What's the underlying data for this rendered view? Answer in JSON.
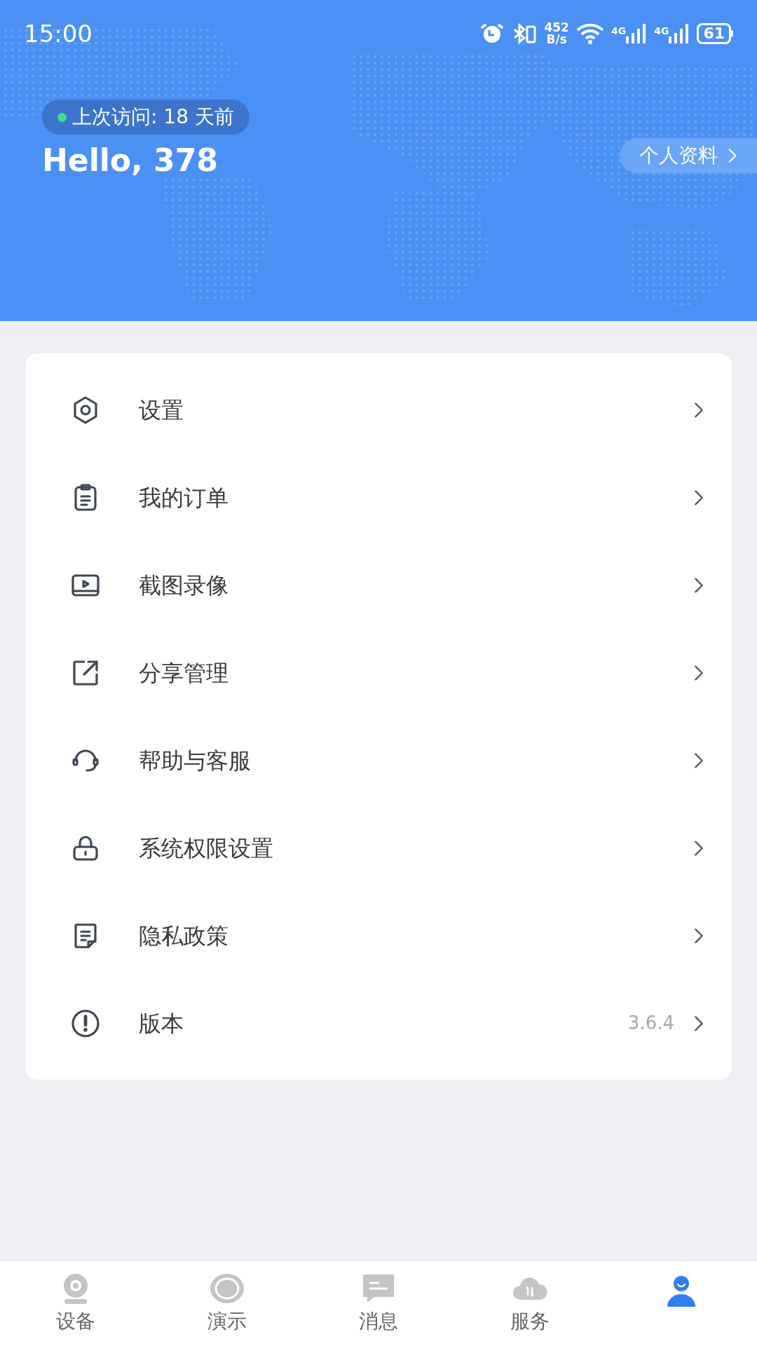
{
  "status_bar": {
    "time": "15:00",
    "net_speed_value": "452",
    "net_speed_unit": "B/s",
    "sim1": "4G",
    "sim2": "4G",
    "battery": "61"
  },
  "header": {
    "last_visit": "上次访问: 18 天前",
    "online": true,
    "greeting": "Hello, 378",
    "profile_link": "个人资料"
  },
  "menu": [
    {
      "kind": "settings",
      "label": "设置"
    },
    {
      "kind": "orders",
      "label": "我的订单"
    },
    {
      "kind": "video",
      "label": "截图录像"
    },
    {
      "kind": "share",
      "label": "分享管理"
    },
    {
      "kind": "help",
      "label": "帮助与客服"
    },
    {
      "kind": "lock",
      "label": "系统权限设置"
    },
    {
      "kind": "privacy",
      "label": "隐私政策"
    },
    {
      "kind": "version",
      "label": "版本",
      "value": "3.6.4"
    }
  ],
  "tabs": [
    {
      "kind": "camera",
      "label": "设备",
      "selected": false
    },
    {
      "kind": "demo",
      "label": "演示",
      "selected": false
    },
    {
      "kind": "message",
      "label": "消息",
      "selected": false
    },
    {
      "kind": "cloud",
      "label": "服务",
      "selected": false
    },
    {
      "kind": "user",
      "selected": true
    }
  ]
}
